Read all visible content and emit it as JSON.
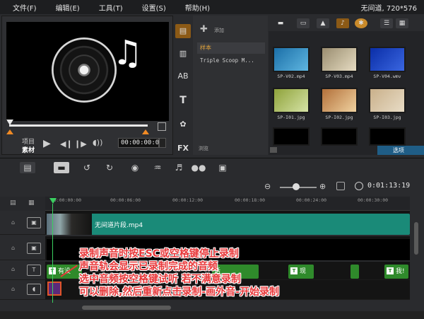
{
  "menu": {
    "items": [
      "文件(F)",
      "编辑(E)",
      "工具(T)",
      "设置(S)",
      "帮助(H)"
    ],
    "project_info": "无间道, 720*576"
  },
  "preview": {
    "mode_project": "项目",
    "mode_clip": "素材",
    "timecode": "00:00:00:00"
  },
  "library": {
    "add_label": "添加",
    "folders": [
      "样本",
      "Triple Scoop M..."
    ],
    "browse_label": "浏览",
    "options_label": "选项",
    "thumbnails": [
      {
        "label": "SP-V02.mp4"
      },
      {
        "label": "SP-V03.mp4"
      },
      {
        "label": "SP-V04.wmv"
      },
      {
        "label": "SP-I01.jpg"
      },
      {
        "label": "SP-I02.jpg"
      },
      {
        "label": "SP-I03.jpg"
      }
    ]
  },
  "timeline": {
    "timecode": "0:01:13:19",
    "ruler_ticks": [
      "00:00:00:00",
      "00:00:06:00",
      "00:00:12:00",
      "00:00:18:00",
      "00:00:24:00",
      "00:00:30:00"
    ],
    "video_clip_label": "无间道片段.mp4",
    "title_clips": [
      "有没",
      "话",
      "现",
      "我!"
    ]
  },
  "annotation": {
    "lines": [
      "录制声音时按ESC或空格键停止录制",
      "声音轨会显示已录制完成的音频",
      "选中音频按空格键试听 若不满意录制",
      "可以删除,然后重新点击录制-画外音-开始录制"
    ]
  }
}
